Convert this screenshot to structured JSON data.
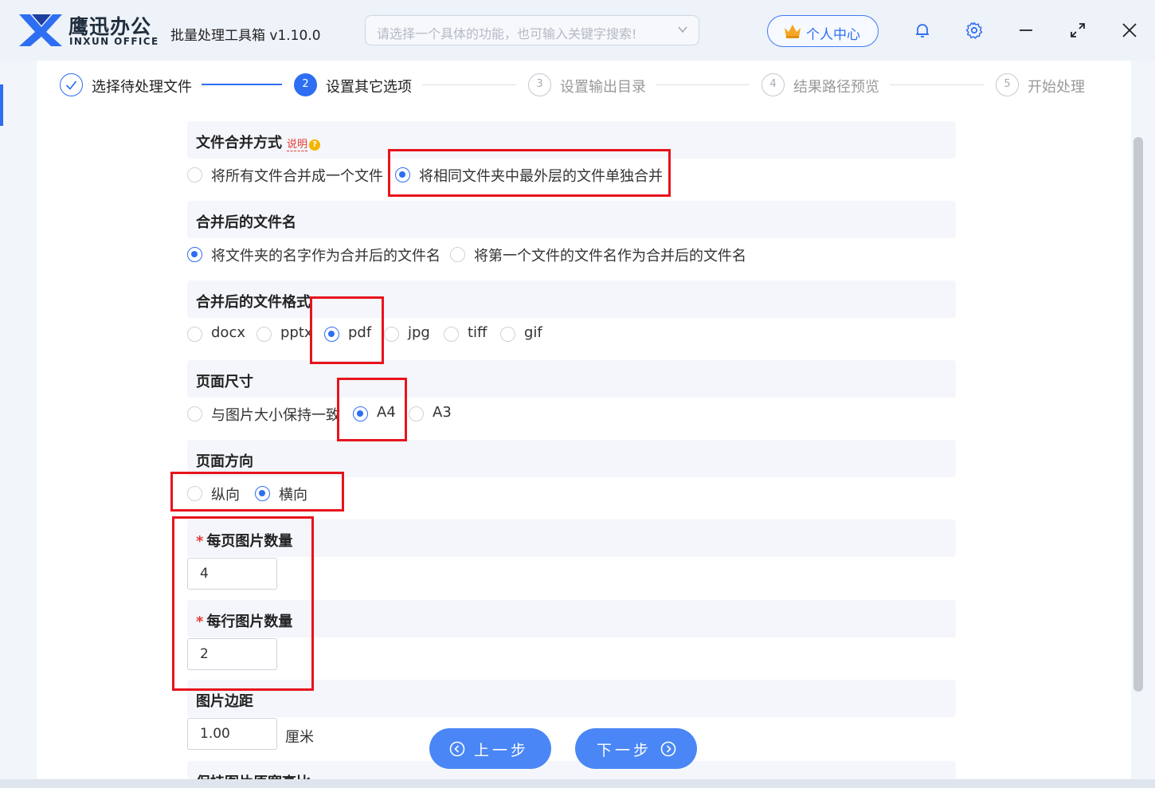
{
  "header": {
    "brand_cn": "鹰迅办公",
    "brand_en": "INXUN OFFICE",
    "app_title": "批量处理工具箱 v1.10.0",
    "search_placeholder": "请选择一个具体的功能，也可输入关键字搜索!",
    "user_center": "个人中心",
    "icons": [
      "bell-icon",
      "gear-icon",
      "minimize-icon",
      "expand-icon",
      "close-icon"
    ]
  },
  "steps": [
    {
      "num": "",
      "label": "选择待处理文件",
      "state": "done"
    },
    {
      "num": "2",
      "label": "设置其它选项",
      "state": "active"
    },
    {
      "num": "3",
      "label": "设置输出目录",
      "state": "pending"
    },
    {
      "num": "4",
      "label": "结果路径预览",
      "state": "pending"
    },
    {
      "num": "5",
      "label": "开始处理",
      "state": "pending"
    }
  ],
  "sections": {
    "merge_mode": {
      "title": "文件合并方式",
      "hint": "说明",
      "options": [
        "将所有文件合并成一个文件",
        "将相同文件夹中最外层的文件单独合并"
      ],
      "selected": "将相同文件夹中最外层的文件单独合并"
    },
    "merged_name": {
      "title": "合并后的文件名",
      "options": [
        "将文件夹的名字作为合并后的文件名",
        "将第一个文件的文件名作为合并后的文件名"
      ],
      "selected": "将文件夹的名字作为合并后的文件名"
    },
    "merged_format": {
      "title": "合并后的文件格式",
      "options": [
        "docx",
        "pptx",
        "pdf",
        "jpg",
        "tiff",
        "gif"
      ],
      "selected": "pdf"
    },
    "page_size": {
      "title": "页面尺寸",
      "options": [
        "与图片大小保持一致",
        "A4",
        "A3"
      ],
      "selected": "A4"
    },
    "orientation": {
      "title": "页面方向",
      "options": [
        "纵向",
        "横向"
      ],
      "selected": "横向"
    },
    "images_per_page": {
      "required_mark": "*",
      "title": "每页图片数量",
      "value": "4"
    },
    "images_per_row": {
      "required_mark": "*",
      "title": "每行图片数量",
      "value": "2"
    },
    "image_margin": {
      "title": "图片边距",
      "value": "1.00",
      "unit": "厘米"
    },
    "keep_ratio": {
      "title": "保持图片原宽高比"
    }
  },
  "nav": {
    "prev": "上一步",
    "next": "下一步"
  },
  "colors": {
    "accent": "#2e6ef2",
    "highlight": "#e8131c",
    "button": "#4a86f5"
  }
}
